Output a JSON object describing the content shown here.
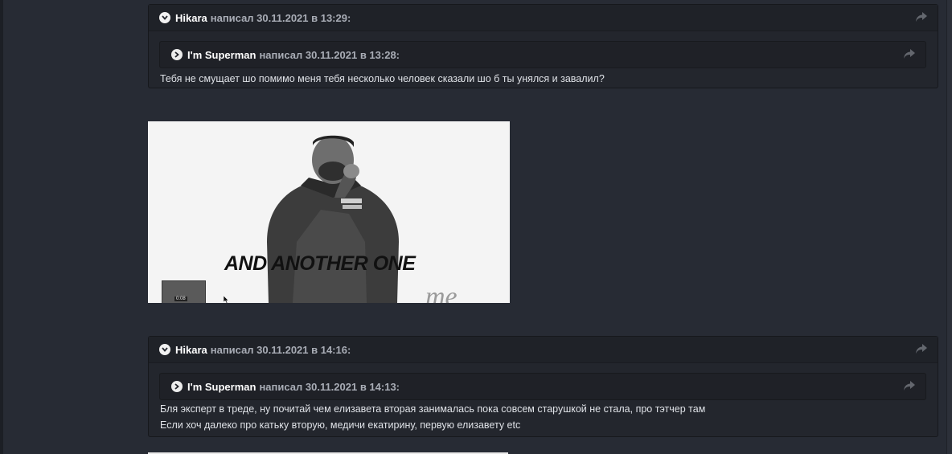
{
  "posts": [
    {
      "author": "Hikara",
      "meta": "написал 30.11.2021 в 13:29:",
      "inner": {
        "author": "I'm Superman",
        "meta": "написал 30.11.2021 в 13:28:"
      },
      "lines": [
        "Тебя не смущает шо помимо меня тебя несколько человек сказали шо б ты унялся и завалил?"
      ]
    },
    {
      "author": "Hikara",
      "meta": "написал 30.11.2021 в 14:16:",
      "inner": {
        "author": "I'm Superman",
        "meta": "написал 30.11.2021 в 14:13:"
      },
      "lines": [
        "Бля эксперт в треде, ну почитай чем елизавета вторая занималась пока совсем старушкой не стала, про тэтчер там",
        "Если хоч далеко про катьку вторую, медичи екатирину, первую елизавету etc"
      ]
    }
  ],
  "gif": {
    "caption": "AND ANOTHER ONE",
    "timestamp": "0:08",
    "watermark": "me"
  },
  "icons": {
    "toggle_open": "chevron-down-icon",
    "toggle_closed": "chevron-right-icon",
    "share": "share-arrow-icon"
  },
  "colors": {
    "background": "#272b34",
    "quote_bg": "#23262d",
    "quote_header": "#1f2228",
    "meta_text": "#a9adb6"
  }
}
